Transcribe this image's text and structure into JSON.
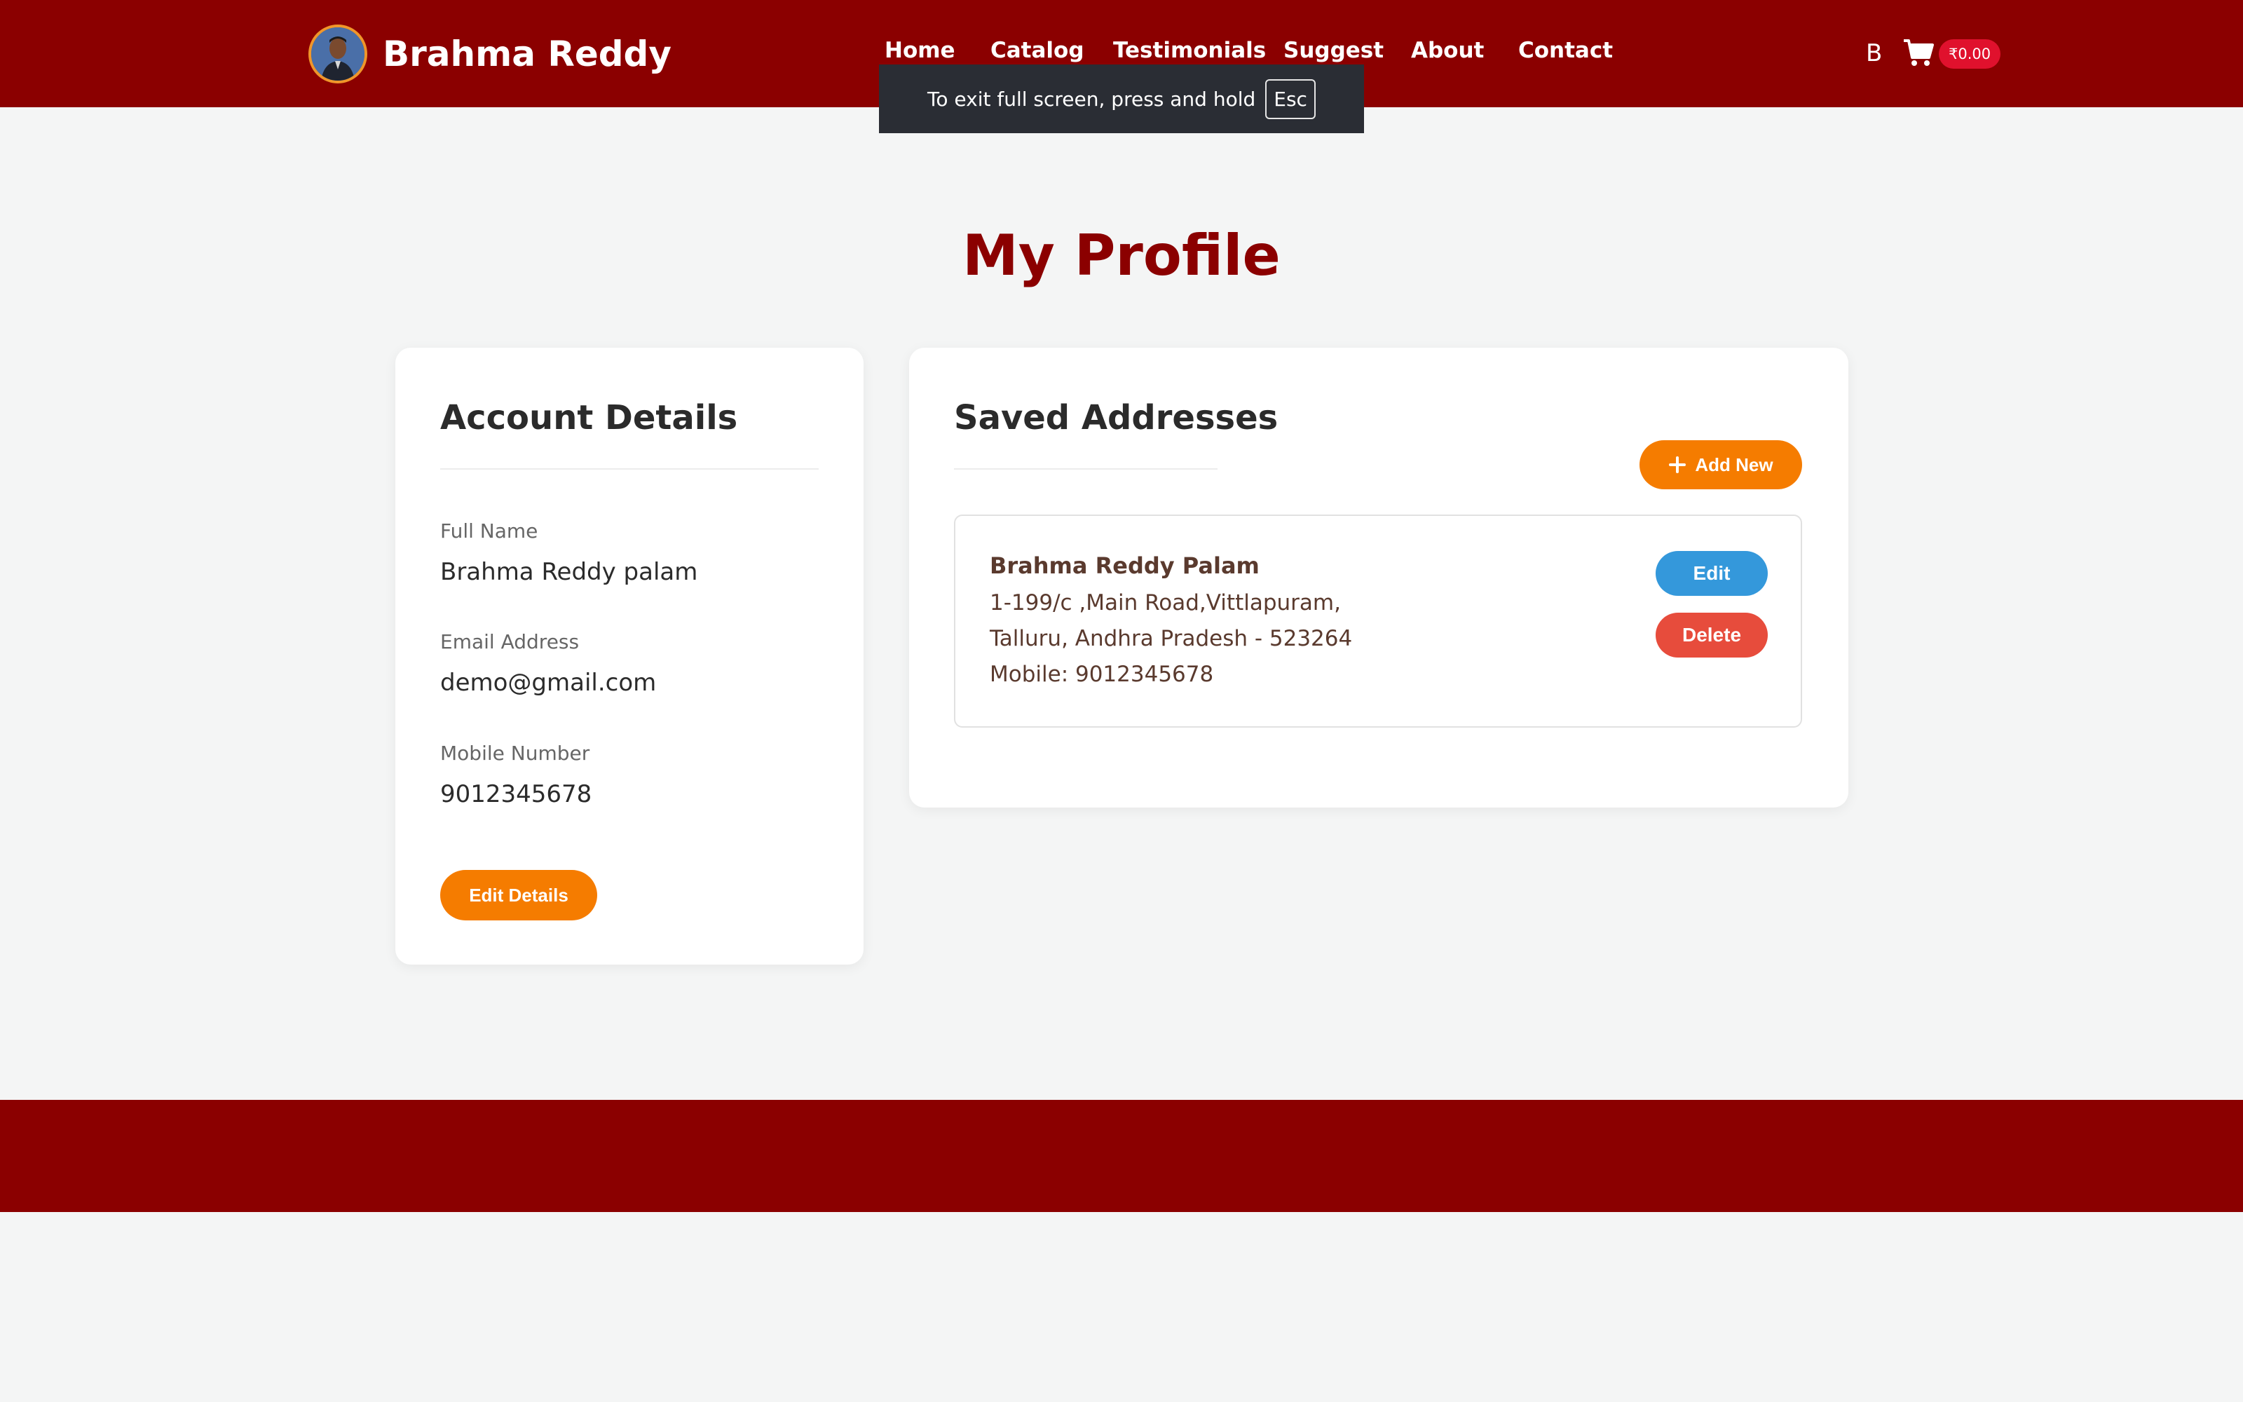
{
  "header": {
    "brand_name": "Brahma Reddy",
    "nav": [
      "Home",
      "Catalog",
      "Testimonials",
      "Suggest",
      "About",
      "Contact"
    ],
    "user_initial": "B",
    "cart_total": "₹0.00"
  },
  "fullscreen_toast": {
    "text": "To exit full screen, press and hold",
    "key": "Esc"
  },
  "page_title": "My Profile",
  "account": {
    "heading": "Account Details",
    "fields": [
      {
        "label": "Full Name",
        "value": "Brahma Reddy palam"
      },
      {
        "label": "Email Address",
        "value": "demo@gmail.com"
      },
      {
        "label": "Mobile Number",
        "value": "9012345678"
      }
    ],
    "edit_button": "Edit Details"
  },
  "addresses": {
    "heading": "Saved Addresses",
    "add_button": "Add New",
    "items": [
      {
        "name": "Brahma Reddy Palam",
        "line1": "1-199/c ,Main Road,Vittlapuram,",
        "line2": "Talluru, Andhra Pradesh - 523264",
        "mobile": "Mobile: 9012345678",
        "edit_label": "Edit",
        "delete_label": "Delete"
      }
    ]
  },
  "colors": {
    "brand": "#8b0000",
    "accent_orange": "#f57c00",
    "edit_blue": "#3498db",
    "delete_red": "#e74c3c",
    "cart_badge": "#e0112d"
  },
  "icons": [
    "avatar-photo",
    "cart-icon",
    "plus-icon"
  ]
}
